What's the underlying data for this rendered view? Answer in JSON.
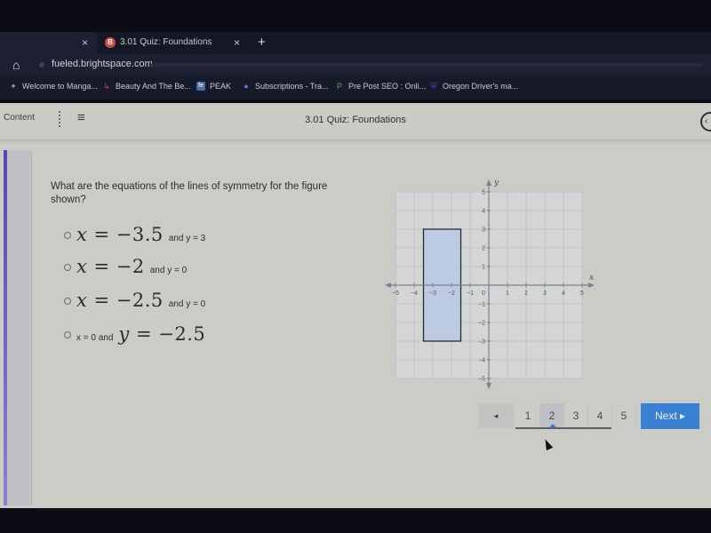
{
  "browser": {
    "tabs": [
      {
        "title": "",
        "active": false
      },
      {
        "title": "3.01 Quiz: Foundations",
        "active": true,
        "favicon": "B"
      }
    ],
    "tab_close_glyph": "×",
    "new_tab_glyph": "+",
    "home_glyph": "⌂",
    "url": "fueled.brightspace.com",
    "bookmarks": [
      {
        "label": "Welcome to Manga...",
        "icon": "manga-icon",
        "glyph": "✦",
        "color": "#9a9a9a"
      },
      {
        "label": "Beauty And The Be...",
        "icon": "beauty-icon",
        "glyph": "↳",
        "color": "#c9443a"
      },
      {
        "label": "PEAK",
        "icon": "peak-icon",
        "glyph": "fe",
        "color": "#4a6fa5"
      },
      {
        "label": "Subscriptions - Tra...",
        "icon": "subscriptions-icon",
        "glyph": "●",
        "color": "#5b7fd6"
      },
      {
        "label": "Pre Post SEO : Onli...",
        "icon": "prepost-icon",
        "glyph": "P",
        "color": "#4caf50"
      },
      {
        "label": "Oregon Driver's ma...",
        "icon": "oregon-icon",
        "glyph": "⛨",
        "color": "#3652c8"
      }
    ]
  },
  "navbar": {
    "content_label": "Content",
    "menu_glyph": "≡",
    "title": "3.01 Quiz: Foundations",
    "back_glyph": "‹"
  },
  "question": {
    "text": "What are the equations of the lines of symmetry for the figure shown?",
    "choices": [
      {
        "math_var": "x",
        "math_rest": " = −3.5",
        "suffix": "and y = 3",
        "prefix": ""
      },
      {
        "math_var": "x",
        "math_rest": " = −2",
        "suffix": "and y = 0",
        "prefix": ""
      },
      {
        "math_var": "x",
        "math_rest": " = −2.5",
        "suffix": "and y = 0",
        "prefix": ""
      },
      {
        "math_var": "y",
        "math_rest": " = −2.5",
        "suffix": "",
        "prefix": "x = 0 and"
      }
    ]
  },
  "graph": {
    "x_label": "x",
    "y_label": "y",
    "x_range": [
      -5,
      5
    ],
    "y_range": [
      -5,
      5
    ],
    "x_ticks": [
      -5,
      -4,
      -3,
      -2,
      -1,
      1,
      2,
      3,
      4,
      5
    ],
    "y_ticks": [
      5,
      4,
      3,
      2,
      1,
      -1,
      -2,
      -3,
      -4,
      -5
    ],
    "origin_label": "0",
    "rectangle": {
      "x_min": -3.5,
      "x_max": -1.5,
      "y_min": -3,
      "y_max": 3,
      "fill": "#bccbe2",
      "stroke": "#2a2b30"
    },
    "grid_color": "#b8bcc9",
    "axis_color": "#7d8191"
  },
  "pagination": {
    "prev_glyph": "◂",
    "pages": [
      "1",
      "2",
      "3",
      "4",
      "5"
    ],
    "current": 2,
    "next_label": "Next ▸"
  }
}
